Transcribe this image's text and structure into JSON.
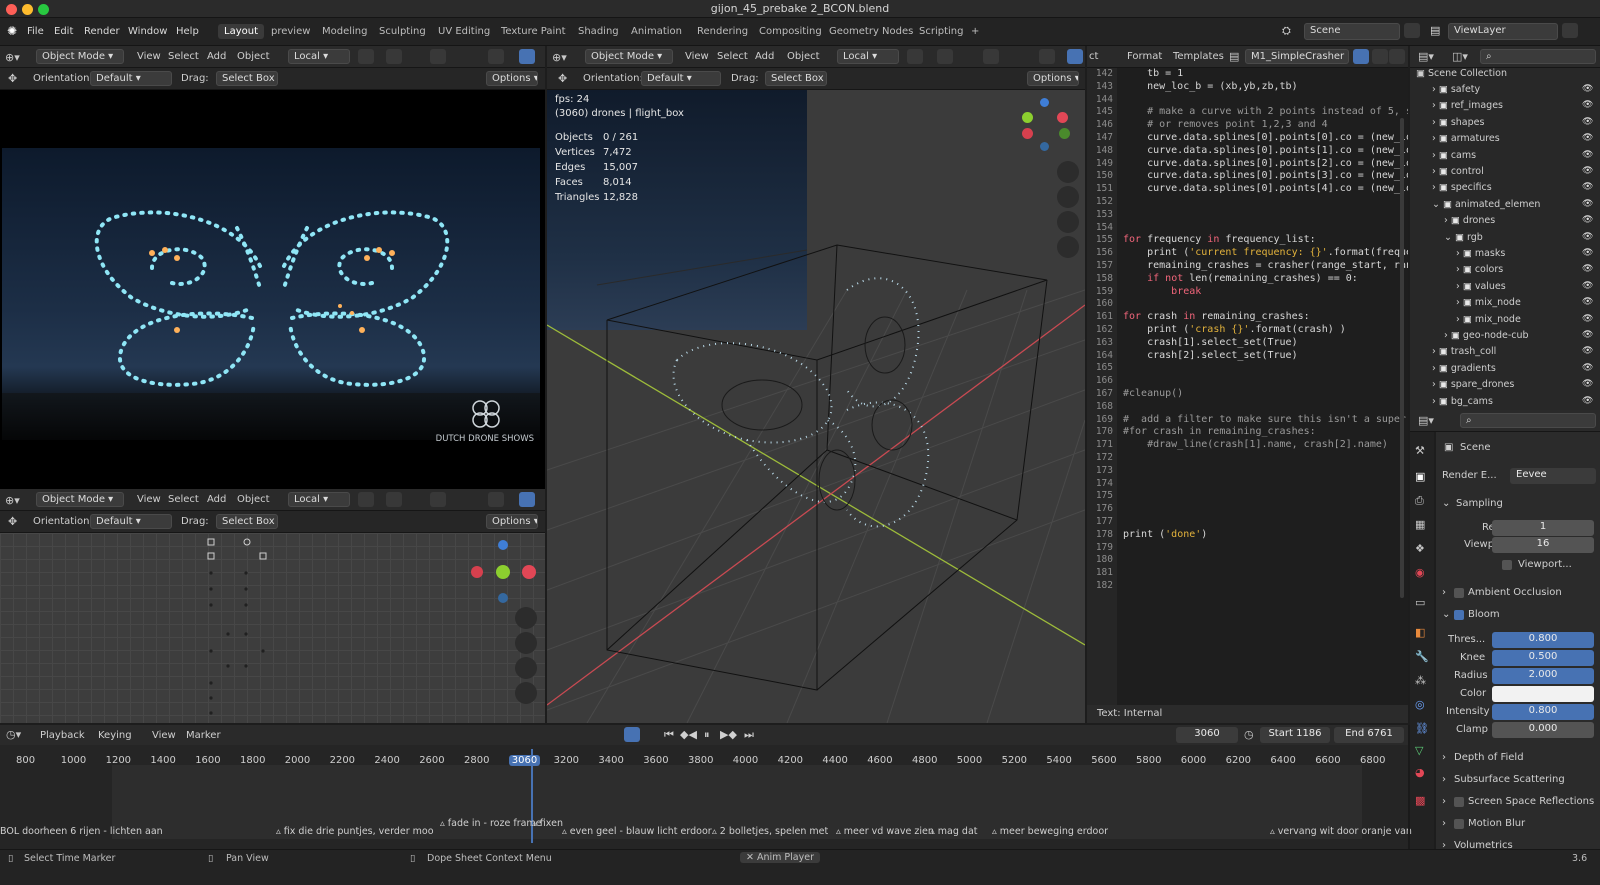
{
  "window": {
    "title": "gijon_45_prebake 2_BCON.blend"
  },
  "menu": [
    "File",
    "Edit",
    "Render",
    "Window",
    "Help"
  ],
  "workspaces": [
    "Layout",
    "preview",
    "Modeling",
    "Sculpting",
    "UV Editing",
    "Texture Paint",
    "Shading",
    "Animation",
    "Rendering",
    "Compositing",
    "Geometry Nodes",
    "Scripting",
    "+"
  ],
  "scene": {
    "name": "Scene",
    "view_layer": "ViewLayer"
  },
  "view_header": {
    "mode": "Object Mode",
    "view": "View",
    "select": "Select",
    "add": "Add",
    "object": "Object",
    "transform": "Local",
    "orientation_label": "Orientation:",
    "orientation": "Default",
    "drag_label": "Drag:",
    "drag": "Select Box",
    "options": "Options"
  },
  "preview": {
    "watermark": "DUTCH DRONE SHOWS"
  },
  "viewport_stats": {
    "fps": "fps: 24",
    "info": "(3060) drones | flight_box",
    "rows": [
      [
        "Objects",
        "0 / 261"
      ],
      [
        "Vertices",
        "7,472"
      ],
      [
        "Edges",
        "15,007"
      ],
      [
        "Faces",
        "8,014"
      ],
      [
        "Triangles",
        "12,828"
      ]
    ]
  },
  "text_editor": {
    "tab_text": "ct",
    "format": "Format",
    "templates": "Templates",
    "file": "M1_SimpleCrasher",
    "footer": "Text: Internal",
    "lines": [
      {
        "n": "142",
        "t": "    tb = 1"
      },
      {
        "n": "143",
        "t": "    new_loc_b = (xb,yb,zb,tb)"
      },
      {
        "n": "144",
        "t": ""
      },
      {
        "n": "145",
        "t": "    # make a curve with 2 points instead of 5, s"
      },
      {
        "n": "146",
        "t": "    # or removes point 1,2,3 and 4"
      },
      {
        "n": "147",
        "t": "    curve.data.splines[0].points[0].co = (new_lo"
      },
      {
        "n": "148",
        "t": "    curve.data.splines[0].points[1].co = (new_lo"
      },
      {
        "n": "149",
        "t": "    curve.data.splines[0].points[2].co = (new_lo"
      },
      {
        "n": "150",
        "t": "    curve.data.splines[0].points[3].co = (new_lo"
      },
      {
        "n": "151",
        "t": "    curve.data.splines[0].points[4].co = (new_lo"
      },
      {
        "n": "152",
        "t": ""
      },
      {
        "n": "153",
        "t": ""
      },
      {
        "n": "154",
        "t": ""
      },
      {
        "n": "155",
        "t": "for frequency in frequency_list:"
      },
      {
        "n": "156",
        "t": "    print ('current frequency: {}'.format(freque"
      },
      {
        "n": "157",
        "t": "    remaining_crashes = crasher(range_start, ran"
      },
      {
        "n": "158",
        "t": "    if not len(remaining_crashes) == 0:"
      },
      {
        "n": "159",
        "t": "        break"
      },
      {
        "n": "160",
        "t": ""
      },
      {
        "n": "161",
        "t": "for crash in remaining_crashes:"
      },
      {
        "n": "162",
        "t": "    print ('crash {}'.format(crash) )"
      },
      {
        "n": "163",
        "t": "    crash[1].select_set(True)"
      },
      {
        "n": "164",
        "t": "    crash[2].select_set(True)"
      },
      {
        "n": "165",
        "t": ""
      },
      {
        "n": "166",
        "t": ""
      },
      {
        "n": "167",
        "t": "#cleanup()"
      },
      {
        "n": "168",
        "t": ""
      },
      {
        "n": "169",
        "t": "#  add a filter to make sure this isn't a super"
      },
      {
        "n": "170",
        "t": "#for crash in remaining_crashes:"
      },
      {
        "n": "171",
        "t": "    #draw_line(crash[1].name, crash[2].name)"
      },
      {
        "n": "172",
        "t": ""
      },
      {
        "n": "173",
        "t": ""
      },
      {
        "n": "174",
        "t": ""
      },
      {
        "n": "175",
        "t": ""
      },
      {
        "n": "176",
        "t": ""
      },
      {
        "n": "177",
        "t": ""
      },
      {
        "n": "178",
        "t": "print ('done')"
      },
      {
        "n": "179",
        "t": ""
      },
      {
        "n": "180",
        "t": ""
      },
      {
        "n": "181",
        "t": ""
      },
      {
        "n": "182",
        "t": ""
      }
    ]
  },
  "outliner": {
    "title": "Scene Collection",
    "items": [
      {
        "label": "safety",
        "indent": 1,
        "expanded": false
      },
      {
        "label": "ref_images",
        "indent": 1,
        "expanded": false
      },
      {
        "label": "shapes",
        "indent": 1,
        "expanded": false
      },
      {
        "label": "armatures",
        "indent": 1,
        "expanded": false
      },
      {
        "label": "cams",
        "indent": 1,
        "expanded": false
      },
      {
        "label": "control",
        "indent": 1,
        "expanded": false
      },
      {
        "label": "specifics",
        "indent": 1,
        "expanded": false
      },
      {
        "label": "animated_elemen",
        "indent": 1,
        "expanded": true
      },
      {
        "label": "drones",
        "indent": 2,
        "expanded": false
      },
      {
        "label": "rgb",
        "indent": 2,
        "expanded": true
      },
      {
        "label": "masks",
        "indent": 3,
        "expanded": false
      },
      {
        "label": "colors",
        "indent": 3,
        "expanded": false
      },
      {
        "label": "values",
        "indent": 3,
        "expanded": false
      },
      {
        "label": "mix_node",
        "indent": 3,
        "expanded": false
      },
      {
        "label": "mix_node",
        "indent": 3,
        "expanded": false
      },
      {
        "label": "geo-node-cub",
        "indent": 2,
        "expanded": false
      },
      {
        "label": "trash_coll",
        "indent": 1,
        "expanded": false
      },
      {
        "label": "gradients",
        "indent": 1,
        "expanded": false
      },
      {
        "label": "spare_drones",
        "indent": 1,
        "expanded": false
      },
      {
        "label": "bg_cams",
        "indent": 1,
        "expanded": false
      }
    ]
  },
  "properties": {
    "scene": "Scene",
    "render_engine_label": "Render E...",
    "render_engine": "Eevee",
    "sampling": "Sampling",
    "render_label": "Render",
    "render_value": "1",
    "viewport_label": "Viewport",
    "viewport_value": "16",
    "viewport_denoise": "Viewport...",
    "ao": "Ambient Occlusion",
    "bloom": "Bloom",
    "bloom_rows": [
      [
        "Thres...",
        "0.800"
      ],
      [
        "Knee",
        "0.500"
      ],
      [
        "Radius",
        "2.000"
      ],
      [
        "Color",
        ""
      ],
      [
        "Intensity",
        "0.800"
      ],
      [
        "Clamp",
        "0.000"
      ]
    ],
    "sections": [
      "Depth of Field",
      "Subsurface Scattering",
      "Screen Space Reflections",
      "Motion Blur",
      "Volumetrics"
    ]
  },
  "timeline": {
    "playback": "Playback",
    "keying": "Keying",
    "view": "View",
    "marker": "Marker",
    "current_frame": "3060",
    "start_label": "Start",
    "start": "1186",
    "end_label": "End",
    "end": "6761",
    "ticks": [
      "800",
      "1000",
      "1200",
      "1400",
      "1600",
      "1800",
      "2000",
      "2200",
      "2400",
      "2600",
      "2800",
      "3060",
      "3200",
      "3400",
      "3600",
      "3800",
      "4000",
      "4200",
      "4400",
      "4600",
      "4800",
      "5000",
      "5200",
      "5400",
      "5600",
      "5800",
      "6000",
      "6200",
      "6400",
      "6600",
      "6800"
    ],
    "markers": [
      "BOL doorheen 6 rijen - lichten aan",
      "fix die drie puntjes, verder moo",
      "fade in - roze frame",
      "fixen",
      "even geel - blauw licht erdoor",
      "2 bolletjes, spelen met",
      "meer vd wave zien",
      "mag dat",
      "meer beweging erdoor",
      "vervang wit door oranje van"
    ]
  },
  "statusbar": {
    "left": "Select Time Marker",
    "mid1": "Pan View",
    "mid2": "Dope Sheet Context Menu",
    "mid3": "Anim Player",
    "version": "3.6"
  }
}
